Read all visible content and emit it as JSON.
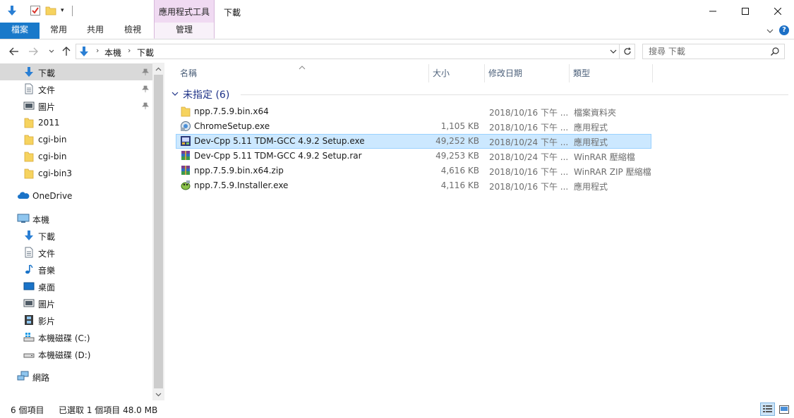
{
  "window": {
    "title": "下載",
    "contextual_group_label": "應用程式工具"
  },
  "ribbon": {
    "tabs": [
      "檔案",
      "常用",
      "共用",
      "檢視",
      "管理"
    ],
    "accent": "#1979ca",
    "contextual_color": "#f0daf2"
  },
  "address": {
    "crumbs": [
      "本機",
      "下載"
    ],
    "search_placeholder": "搜尋 下載"
  },
  "nav": {
    "quick_access": [
      {
        "label": "下載",
        "icon": "download-arrow-icon",
        "pinned": true,
        "selected": true
      },
      {
        "label": "文件",
        "icon": "document-icon",
        "pinned": true
      },
      {
        "label": "圖片",
        "icon": "pictures-icon",
        "pinned": true
      },
      {
        "label": "2011",
        "icon": "folder-icon"
      },
      {
        "label": "cgi-bin",
        "icon": "folder-icon"
      },
      {
        "label": "cgi-bin",
        "icon": "folder-icon"
      },
      {
        "label": "cgi-bin3",
        "icon": "folder-icon"
      }
    ],
    "onedrive": "OneDrive",
    "this_pc": "本機",
    "pc_items": [
      {
        "label": "下載",
        "icon": "download-arrow-icon"
      },
      {
        "label": "文件",
        "icon": "document-icon"
      },
      {
        "label": "音樂",
        "icon": "music-note-icon"
      },
      {
        "label": "桌面",
        "icon": "desktop-icon"
      },
      {
        "label": "圖片",
        "icon": "pictures-icon"
      },
      {
        "label": "影片",
        "icon": "film-icon"
      },
      {
        "label": "本機磁碟 (C:)",
        "icon": "windows-drive-icon"
      },
      {
        "label": "本機磁碟 (D:)",
        "icon": "drive-icon"
      }
    ],
    "network": "網路"
  },
  "columns": {
    "name": "名稱",
    "size": "大小",
    "date": "修改日期",
    "type": "類型"
  },
  "group": {
    "label": "未指定 (6)"
  },
  "files": [
    {
      "name": "npp.7.5.9.bin.x64",
      "size": "",
      "date": "2018/10/16 下午 ...",
      "type": "檔案資料夾",
      "icon": "folder-icon"
    },
    {
      "name": "ChromeSetup.exe",
      "size": "1,105 KB",
      "date": "2018/10/16 下午 ...",
      "type": "應用程式",
      "icon": "installer-icon"
    },
    {
      "name": "Dev-Cpp 5.11 TDM-GCC 4.9.2 Setup.exe",
      "size": "49,252 KB",
      "date": "2018/10/24 下午 ...",
      "type": "應用程式",
      "icon": "devcpp-icon",
      "selected": true
    },
    {
      "name": "Dev-Cpp 5.11 TDM-GCC 4.9.2 Setup.rar",
      "size": "49,253 KB",
      "date": "2018/10/24 下午 ...",
      "type": "WinRAR 壓縮檔",
      "icon": "winrar-icon"
    },
    {
      "name": "npp.7.5.9.bin.x64.zip",
      "size": "4,616 KB",
      "date": "2018/10/16 下午 ...",
      "type": "WinRAR ZIP 壓縮檔",
      "icon": "winrar-icon"
    },
    {
      "name": "npp.7.5.9.Installer.exe",
      "size": "4,116 KB",
      "date": "2018/10/16 下午 ...",
      "type": "應用程式",
      "icon": "notepadpp-icon"
    }
  ],
  "status": {
    "count": "6 個項目",
    "selected": "已選取 1 個項目  48.0 MB"
  }
}
